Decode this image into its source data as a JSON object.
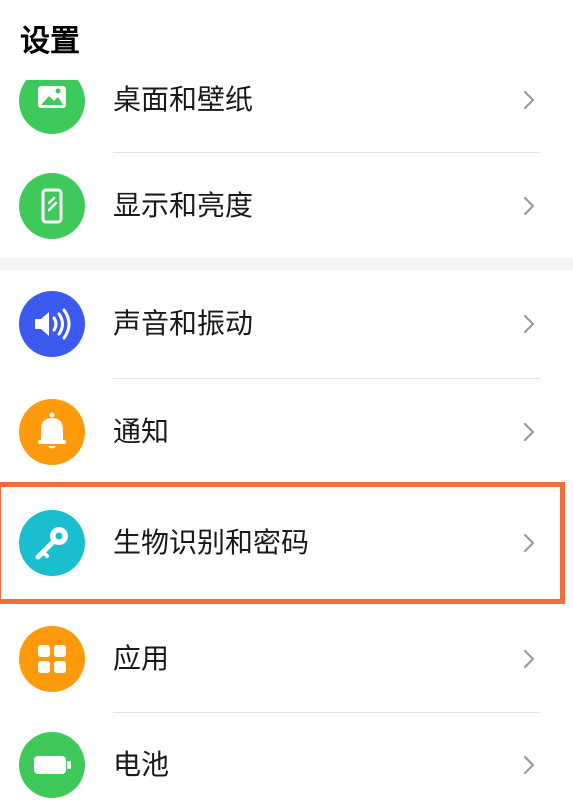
{
  "header": {
    "title": "设置"
  },
  "items": [
    {
      "label": "桌面和壁纸",
      "icon": "wallpaper-icon",
      "color": "#3ec95a"
    },
    {
      "label": "显示和亮度",
      "icon": "display-icon",
      "color": "#3ec95a"
    },
    {
      "label": "声音和振动",
      "icon": "speaker-icon",
      "color": "#3d5af0"
    },
    {
      "label": "通知",
      "icon": "bell-icon",
      "color": "#ff9a0d"
    },
    {
      "label": "生物识别和密码",
      "icon": "key-icon",
      "color": "#19bfcf"
    },
    {
      "label": "应用",
      "icon": "apps-grid-icon",
      "color": "#ff9a0d"
    },
    {
      "label": "电池",
      "icon": "battery-icon",
      "color": "#3ec95a"
    }
  ],
  "highlight": {
    "target": "生物识别和密码",
    "color": "#f26c3c"
  }
}
